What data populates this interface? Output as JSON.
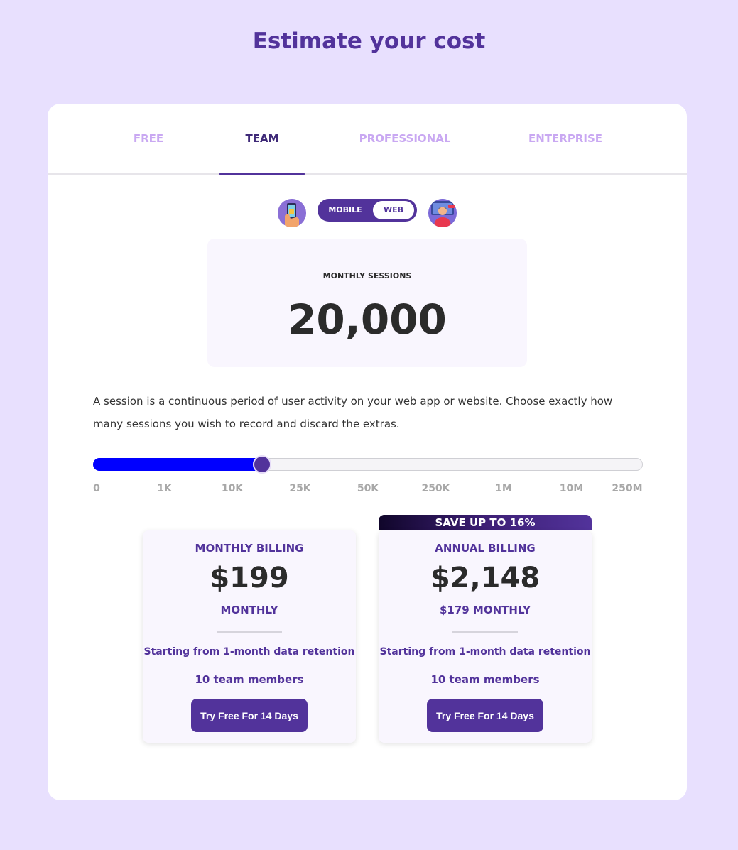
{
  "page": {
    "title": "Estimate your cost"
  },
  "tabs": [
    {
      "label": "FREE",
      "active": false
    },
    {
      "label": "TEAM",
      "active": true
    },
    {
      "label": "PROFESSIONAL",
      "active": false
    },
    {
      "label": "ENTERPRISE",
      "active": false
    }
  ],
  "platform": {
    "left_label": "MOBILE",
    "right_label": "WEB",
    "selected": "WEB",
    "left_icon": "phone-in-hand-icon",
    "right_icon": "person-with-browser-icon"
  },
  "sessions": {
    "label": "MONTHLY SESSIONS",
    "value": "20,000"
  },
  "description": "A session is a continuous period of user activity on your web app or website. Choose exactly how many sessions you wish to record and discard the extras.",
  "slider": {
    "ticks": [
      "0",
      "1K",
      "10K",
      "25K",
      "50K",
      "250K",
      "1M",
      "10M",
      "250M"
    ],
    "selected_fraction": 0.307,
    "fill_color": "#0000ff",
    "thumb_color": "#52339b"
  },
  "pricing": {
    "save_banner": "SAVE UP TO 16%",
    "monthly": {
      "title": "MONTHLY BILLING",
      "amount": "$199",
      "sub": "MONTHLY",
      "retention": "Starting from 1-month data retention",
      "members": "10 team members",
      "button": "Try Free For 14 Days"
    },
    "annual": {
      "title": "ANNUAL BILLING",
      "amount": "$2,148",
      "sub": "$179 MONTHLY",
      "retention": "Starting from 1-month data retention",
      "members": "10 team members",
      "button": "Try Free For 14 Days"
    }
  },
  "colors": {
    "background": "#e8e0fe",
    "brand": "#52339b",
    "tab_inactive": "#c9a8f2"
  }
}
